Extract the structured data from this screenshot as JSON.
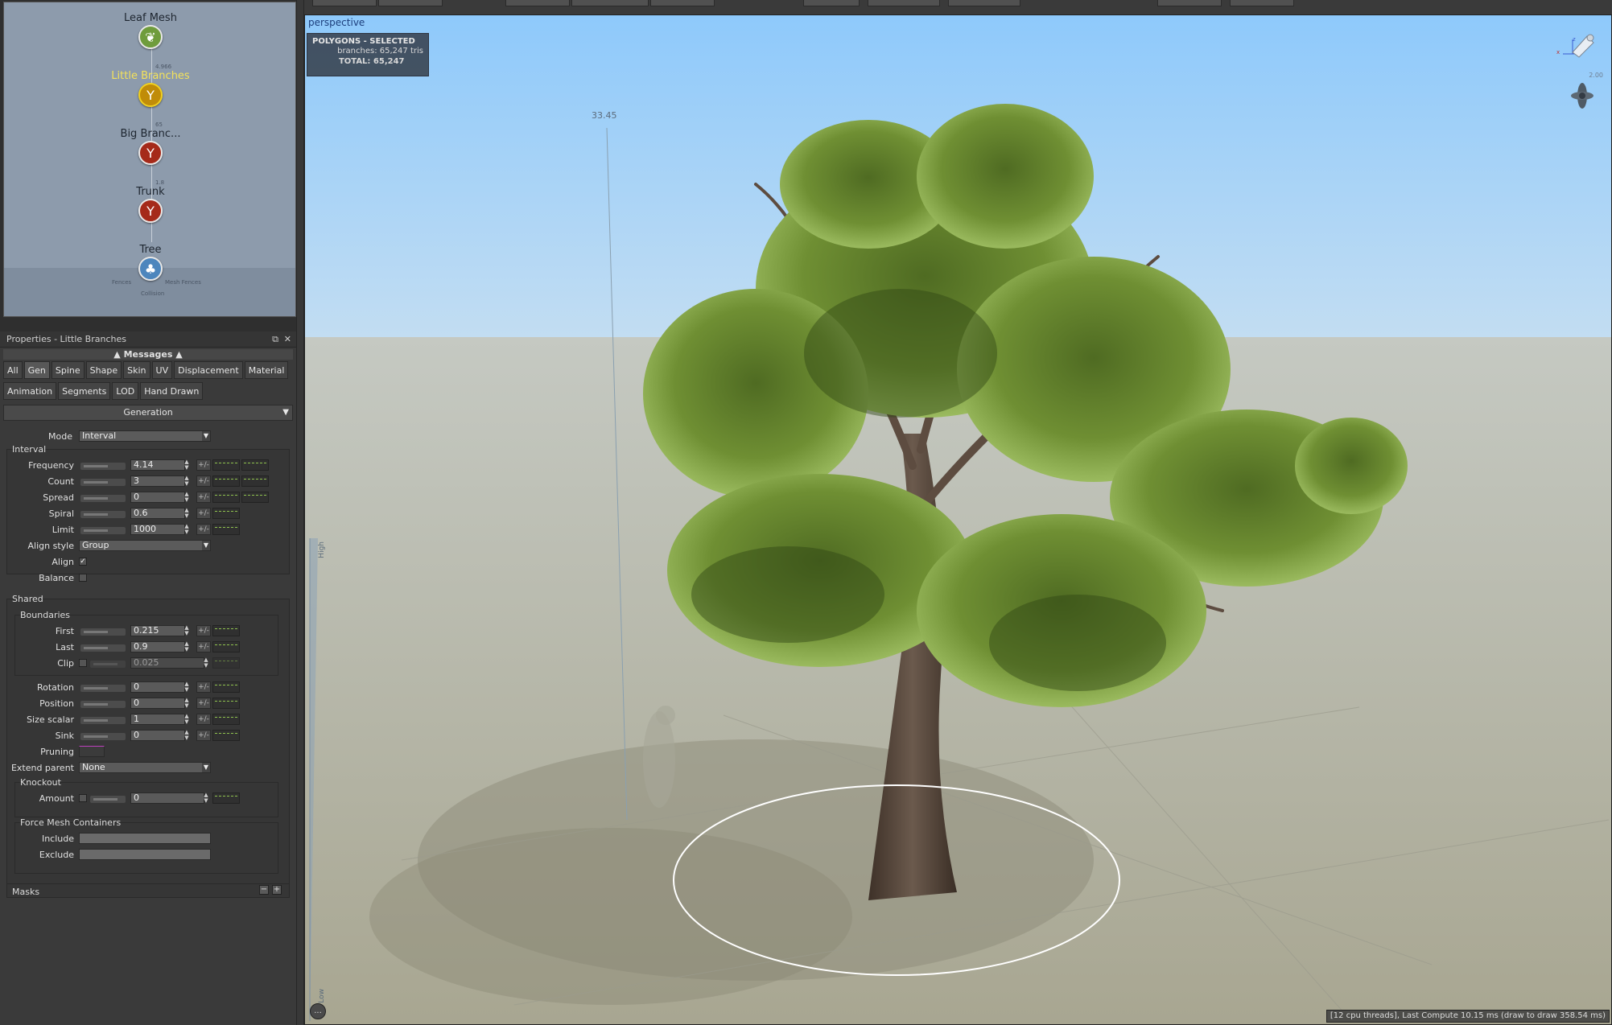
{
  "graph": {
    "nodes": [
      {
        "label": "Leaf Mesh",
        "icon": "leaf-icon",
        "color": "#6f9c3c"
      },
      {
        "label": "Little Branches",
        "icon": "branch-icon",
        "color": "#c08c08",
        "selected": true
      },
      {
        "label": "Big Branc...",
        "icon": "branch-icon",
        "color": "#a52a1a"
      },
      {
        "label": "Trunk",
        "icon": "branch-icon",
        "color": "#a52a1a"
      },
      {
        "label": "Tree",
        "icon": "tree-icon",
        "color": "#4d86bd"
      }
    ],
    "wire_labels": [
      "4.966",
      "65",
      "1.8"
    ],
    "subnodes": [
      "Fences",
      "Mesh Fences",
      "Collision"
    ]
  },
  "properties": {
    "title": "Properties - Little Branches",
    "messages": "Messages",
    "tabs_row1": [
      "All",
      "Gen",
      "Spine",
      "Shape",
      "Skin",
      "UV",
      "Displacement",
      "Material"
    ],
    "tabs_row2": [
      "Animation",
      "Segments",
      "LOD",
      "Hand Drawn"
    ],
    "active_tab": "Gen",
    "section": "Generation",
    "mode": {
      "label": "Mode",
      "value": "Interval"
    },
    "interval_group": "Interval",
    "interval": [
      {
        "label": "Frequency",
        "value": "4.14"
      },
      {
        "label": "Count",
        "value": "3"
      },
      {
        "label": "Spread",
        "value": "0"
      },
      {
        "label": "Spiral",
        "value": "0.6"
      },
      {
        "label": "Limit",
        "value": "1000"
      }
    ],
    "align_style": {
      "label": "Align style",
      "value": "Group"
    },
    "align": {
      "label": "Align",
      "checked": true
    },
    "balance": {
      "label": "Balance",
      "checked": false
    },
    "shared_group": "Shared",
    "boundaries_group": "Boundaries",
    "boundaries": [
      {
        "label": "First",
        "value": "0.215"
      },
      {
        "label": "Last",
        "value": "0.9"
      },
      {
        "label": "Clip",
        "value": "0.025"
      }
    ],
    "shared": [
      {
        "label": "Rotation",
        "value": "0"
      },
      {
        "label": "Position",
        "value": "0"
      },
      {
        "label": "Size scalar",
        "value": "1"
      },
      {
        "label": "Sink",
        "value": "0"
      }
    ],
    "pruning": {
      "label": "Pruning"
    },
    "extend_parent": {
      "label": "Extend parent",
      "value": "None"
    },
    "knockout_group": "Knockout",
    "amount": {
      "label": "Amount",
      "value": "0"
    },
    "force_group": "Force Mesh Containers",
    "include": {
      "label": "Include",
      "value": ""
    },
    "exclude": {
      "label": "Exclude",
      "value": ""
    },
    "masks": "Masks",
    "pm_label": "+/-"
  },
  "viewport": {
    "label": "perspective",
    "hud_title": "POLYGONS - SELECTED",
    "branches_label": "branches:",
    "branches_value": "65,247",
    "tris_unit": "tris",
    "total_label": "TOTAL:",
    "total_value": "65,247",
    "scale_value": "33.45",
    "light_value": "2.00",
    "high_label": "High",
    "low_label": "Low",
    "status": "[12 cpu threads], Last Compute 10.15 ms (draw to draw 358.54 ms)",
    "more": "..."
  }
}
